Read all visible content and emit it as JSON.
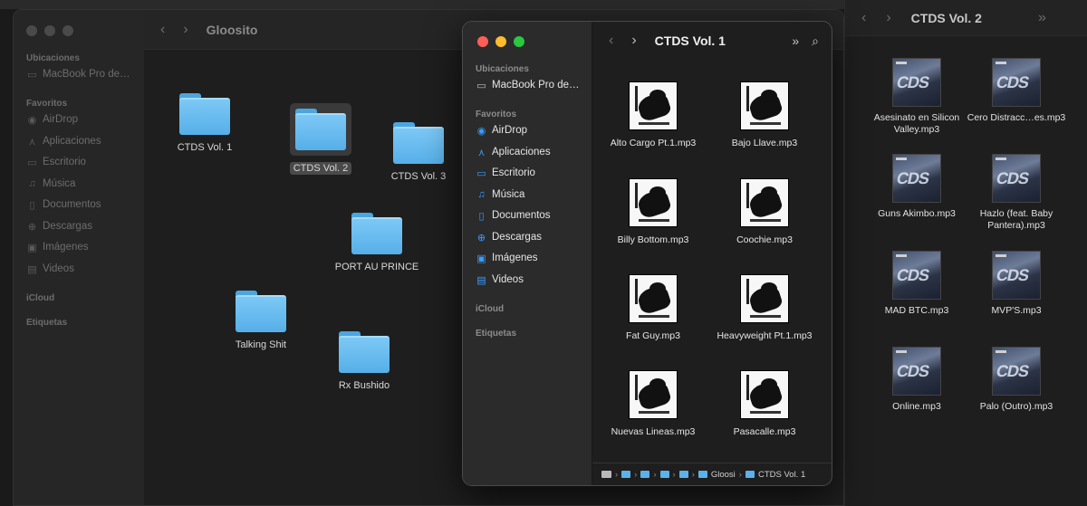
{
  "right_window": {
    "title": "CTDS Vol. 2",
    "nav_back": "‹",
    "nav_forward": "›",
    "more": "»",
    "items": [
      {
        "label": "Asesinato en Silicon Valley.mp3"
      },
      {
        "label": "Cero Distracc…es.mp3"
      },
      {
        "label": "Guns Akimbo.mp3"
      },
      {
        "label": "Hazlo (feat. Baby Pantera).mp3"
      },
      {
        "label": "MAD BTC.mp3"
      },
      {
        "label": "MVP'S.mp3"
      },
      {
        "label": "Online.mp3"
      },
      {
        "label": "Palo (Outro).mp3"
      }
    ],
    "cover_text": "CDS"
  },
  "left_window": {
    "title": "Gloosito",
    "nav_back": "‹",
    "nav_forward": "›",
    "sidebar": {
      "locations_header": "Ubicaciones",
      "locations": [
        {
          "label": "MacBook Pro de…"
        }
      ],
      "favorites_header": "Favoritos",
      "favorites": [
        {
          "label": "AirDrop"
        },
        {
          "label": "Aplicaciones"
        },
        {
          "label": "Escritorio"
        },
        {
          "label": "Música"
        },
        {
          "label": "Documentos"
        },
        {
          "label": "Descargas"
        },
        {
          "label": "Imágenes"
        },
        {
          "label": "Videos"
        }
      ],
      "icloud_header": "iCloud",
      "tags_header": "Etiquetas"
    },
    "folders": [
      {
        "label": "CTDS Vol. 1"
      },
      {
        "label": "CTDS Vol. 2"
      },
      {
        "label": "CTDS Vol. 3"
      },
      {
        "label": "PORT AU PRINCE"
      },
      {
        "label": "Talking Shit"
      },
      {
        "label": "Rx Bushido"
      }
    ]
  },
  "front_window": {
    "title": "CTDS Vol. 1",
    "nav_back": "‹",
    "nav_forward": "›",
    "more": "»",
    "search": "⌕",
    "sidebar": {
      "locations_header": "Ubicaciones",
      "locations": [
        {
          "label": "MacBook Pro de…"
        }
      ],
      "favorites_header": "Favoritos",
      "favorites": [
        {
          "label": "AirDrop"
        },
        {
          "label": "Aplicaciones"
        },
        {
          "label": "Escritorio"
        },
        {
          "label": "Música"
        },
        {
          "label": "Documentos"
        },
        {
          "label": "Descargas"
        },
        {
          "label": "Imágenes"
        },
        {
          "label": "Videos"
        }
      ],
      "icloud_header": "iCloud",
      "tags_header": "Etiquetas"
    },
    "files": [
      {
        "label": "Alto Cargo Pt.1.mp3"
      },
      {
        "label": "Bajo Llave.mp3"
      },
      {
        "label": "Billy Bottom.mp3"
      },
      {
        "label": "Coochie.mp3"
      },
      {
        "label": "Fat Guy.mp3"
      },
      {
        "label": "Heavyweight Pt.1.mp3"
      },
      {
        "label": "Nuevas Lineas.mp3"
      },
      {
        "label": "Pasacalle.mp3"
      }
    ],
    "pathbar": {
      "parent": "Gloosi",
      "current": "CTDS Vol. 1",
      "sep": "›"
    }
  },
  "colors": {
    "folder_blue": "#56afe8",
    "accent_blue": "#3b9bff"
  }
}
